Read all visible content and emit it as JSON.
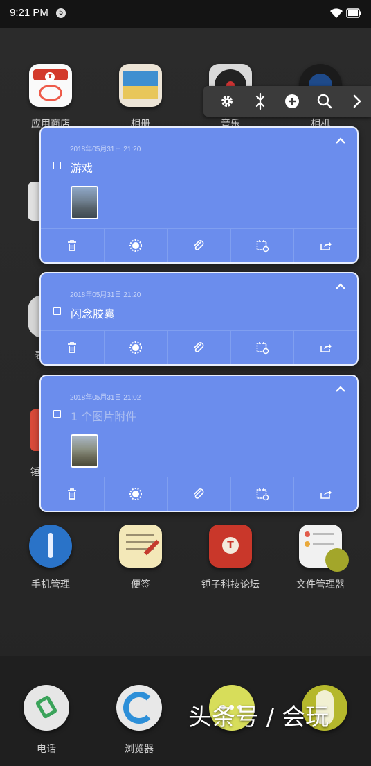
{
  "status_bar": {
    "time": "9:21 PM",
    "notification_count": "5",
    "icons": [
      "wifi-icon",
      "battery-icon"
    ]
  },
  "home": {
    "row1": [
      "应用商店",
      "相册",
      "音乐",
      "相机"
    ],
    "row4": [
      "手机管理",
      "便签",
      "锤子科技论坛",
      "文件管理器"
    ],
    "partial_labels": [
      "表",
      "锤"
    ],
    "dock": [
      "电话",
      "浏览器"
    ]
  },
  "toolstrip": {
    "icons": [
      "gear-icon",
      "pin-icon",
      "add-icon",
      "search-icon",
      "chevron-right-icon"
    ]
  },
  "cards": [
    {
      "date": "2018年05月31日 21:20",
      "title": "游戏",
      "has_image": true,
      "muted": false
    },
    {
      "date": "2018年05月31日 21:20",
      "title": "闪念胶囊",
      "has_image": false,
      "muted": false
    },
    {
      "date": "2018年05月31日 21:02",
      "title": "1 个图片附件",
      "has_image": true,
      "muted": true
    }
  ],
  "card_actions": [
    "trash-icon",
    "brightness-icon",
    "paperclip-icon",
    "reminder-calendar-icon",
    "share-icon"
  ],
  "colors": {
    "card_bg": "#6b8ded",
    "card_border": "#e8eefc",
    "status_bar_bg": "#141414",
    "background": "#262626"
  },
  "watermark": "头条号 / 会玩"
}
